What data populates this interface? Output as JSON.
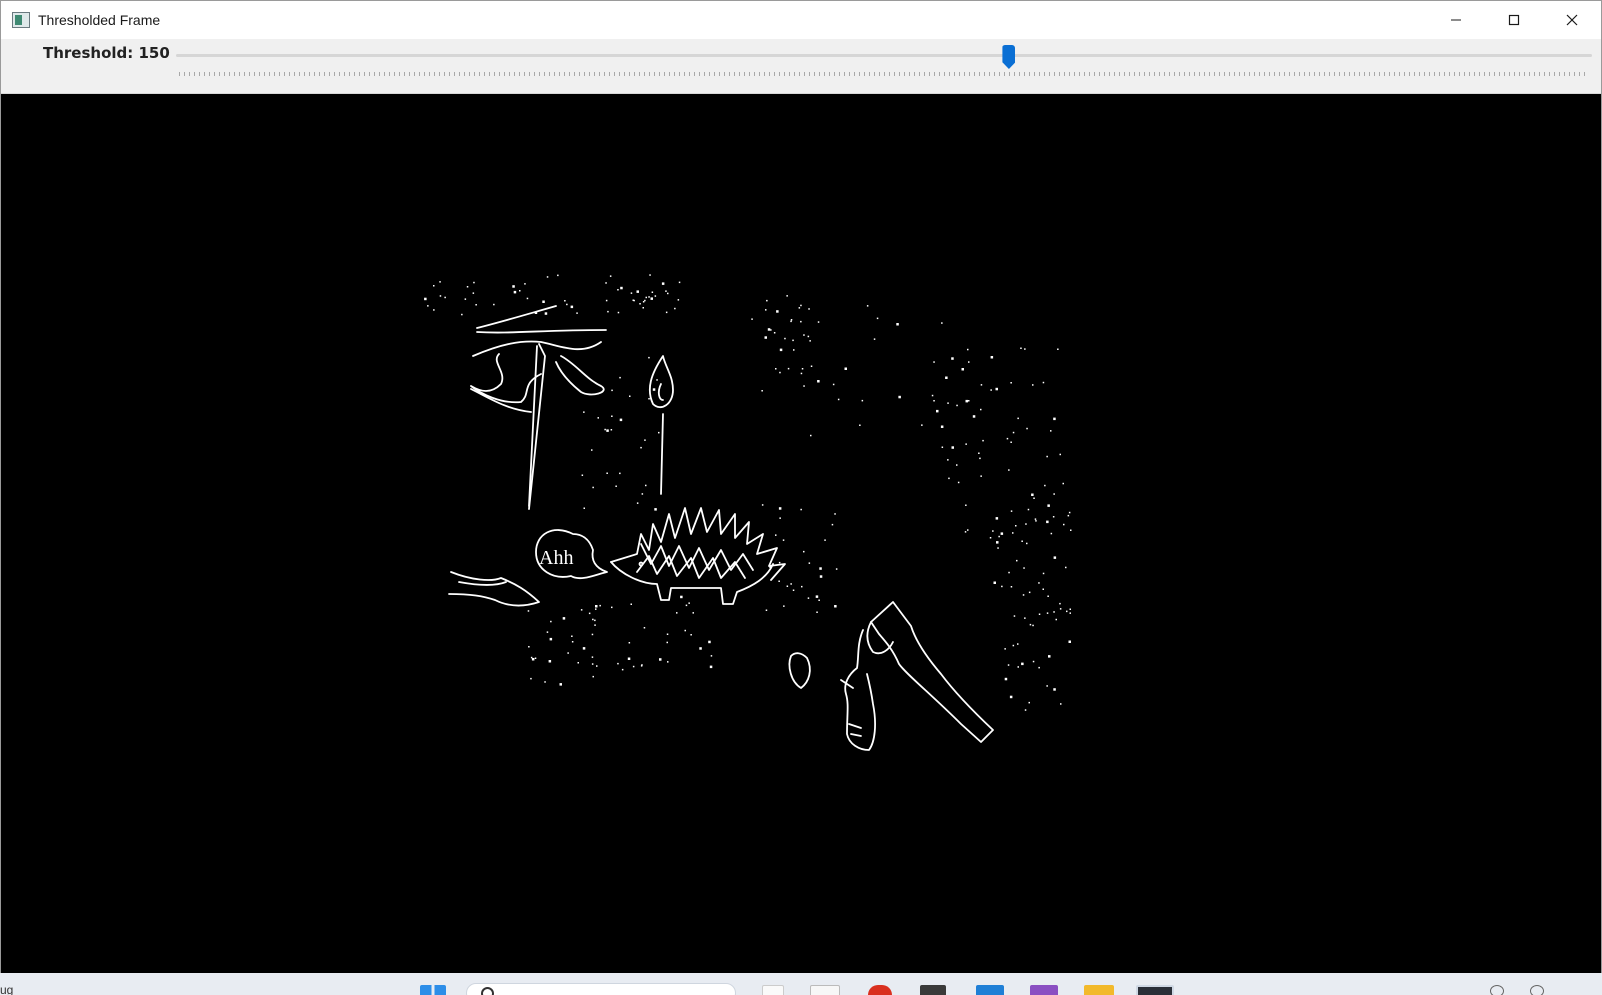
{
  "window": {
    "title": "Thresholded Frame",
    "controls": {
      "minimize": "minimize",
      "maximize": "maximize",
      "close": "close"
    }
  },
  "trackbar": {
    "label": "Threshold: 150",
    "value": 150,
    "min": 0,
    "max": 255,
    "accent_color": "#0a6fd4"
  },
  "canvas": {
    "description_colors": {
      "background": "#000000",
      "foreground": "#ffffff"
    },
    "speech_text": "Ahh"
  },
  "taskbar": {
    "left_text": "ug",
    "icons": [
      "windows-start-icon",
      "search-box",
      "file-icon",
      "app-icon",
      "red-app-icon",
      "book-icon",
      "vscode-icon",
      "visual-studio-icon",
      "folder-icon",
      "terminal-icon"
    ]
  }
}
